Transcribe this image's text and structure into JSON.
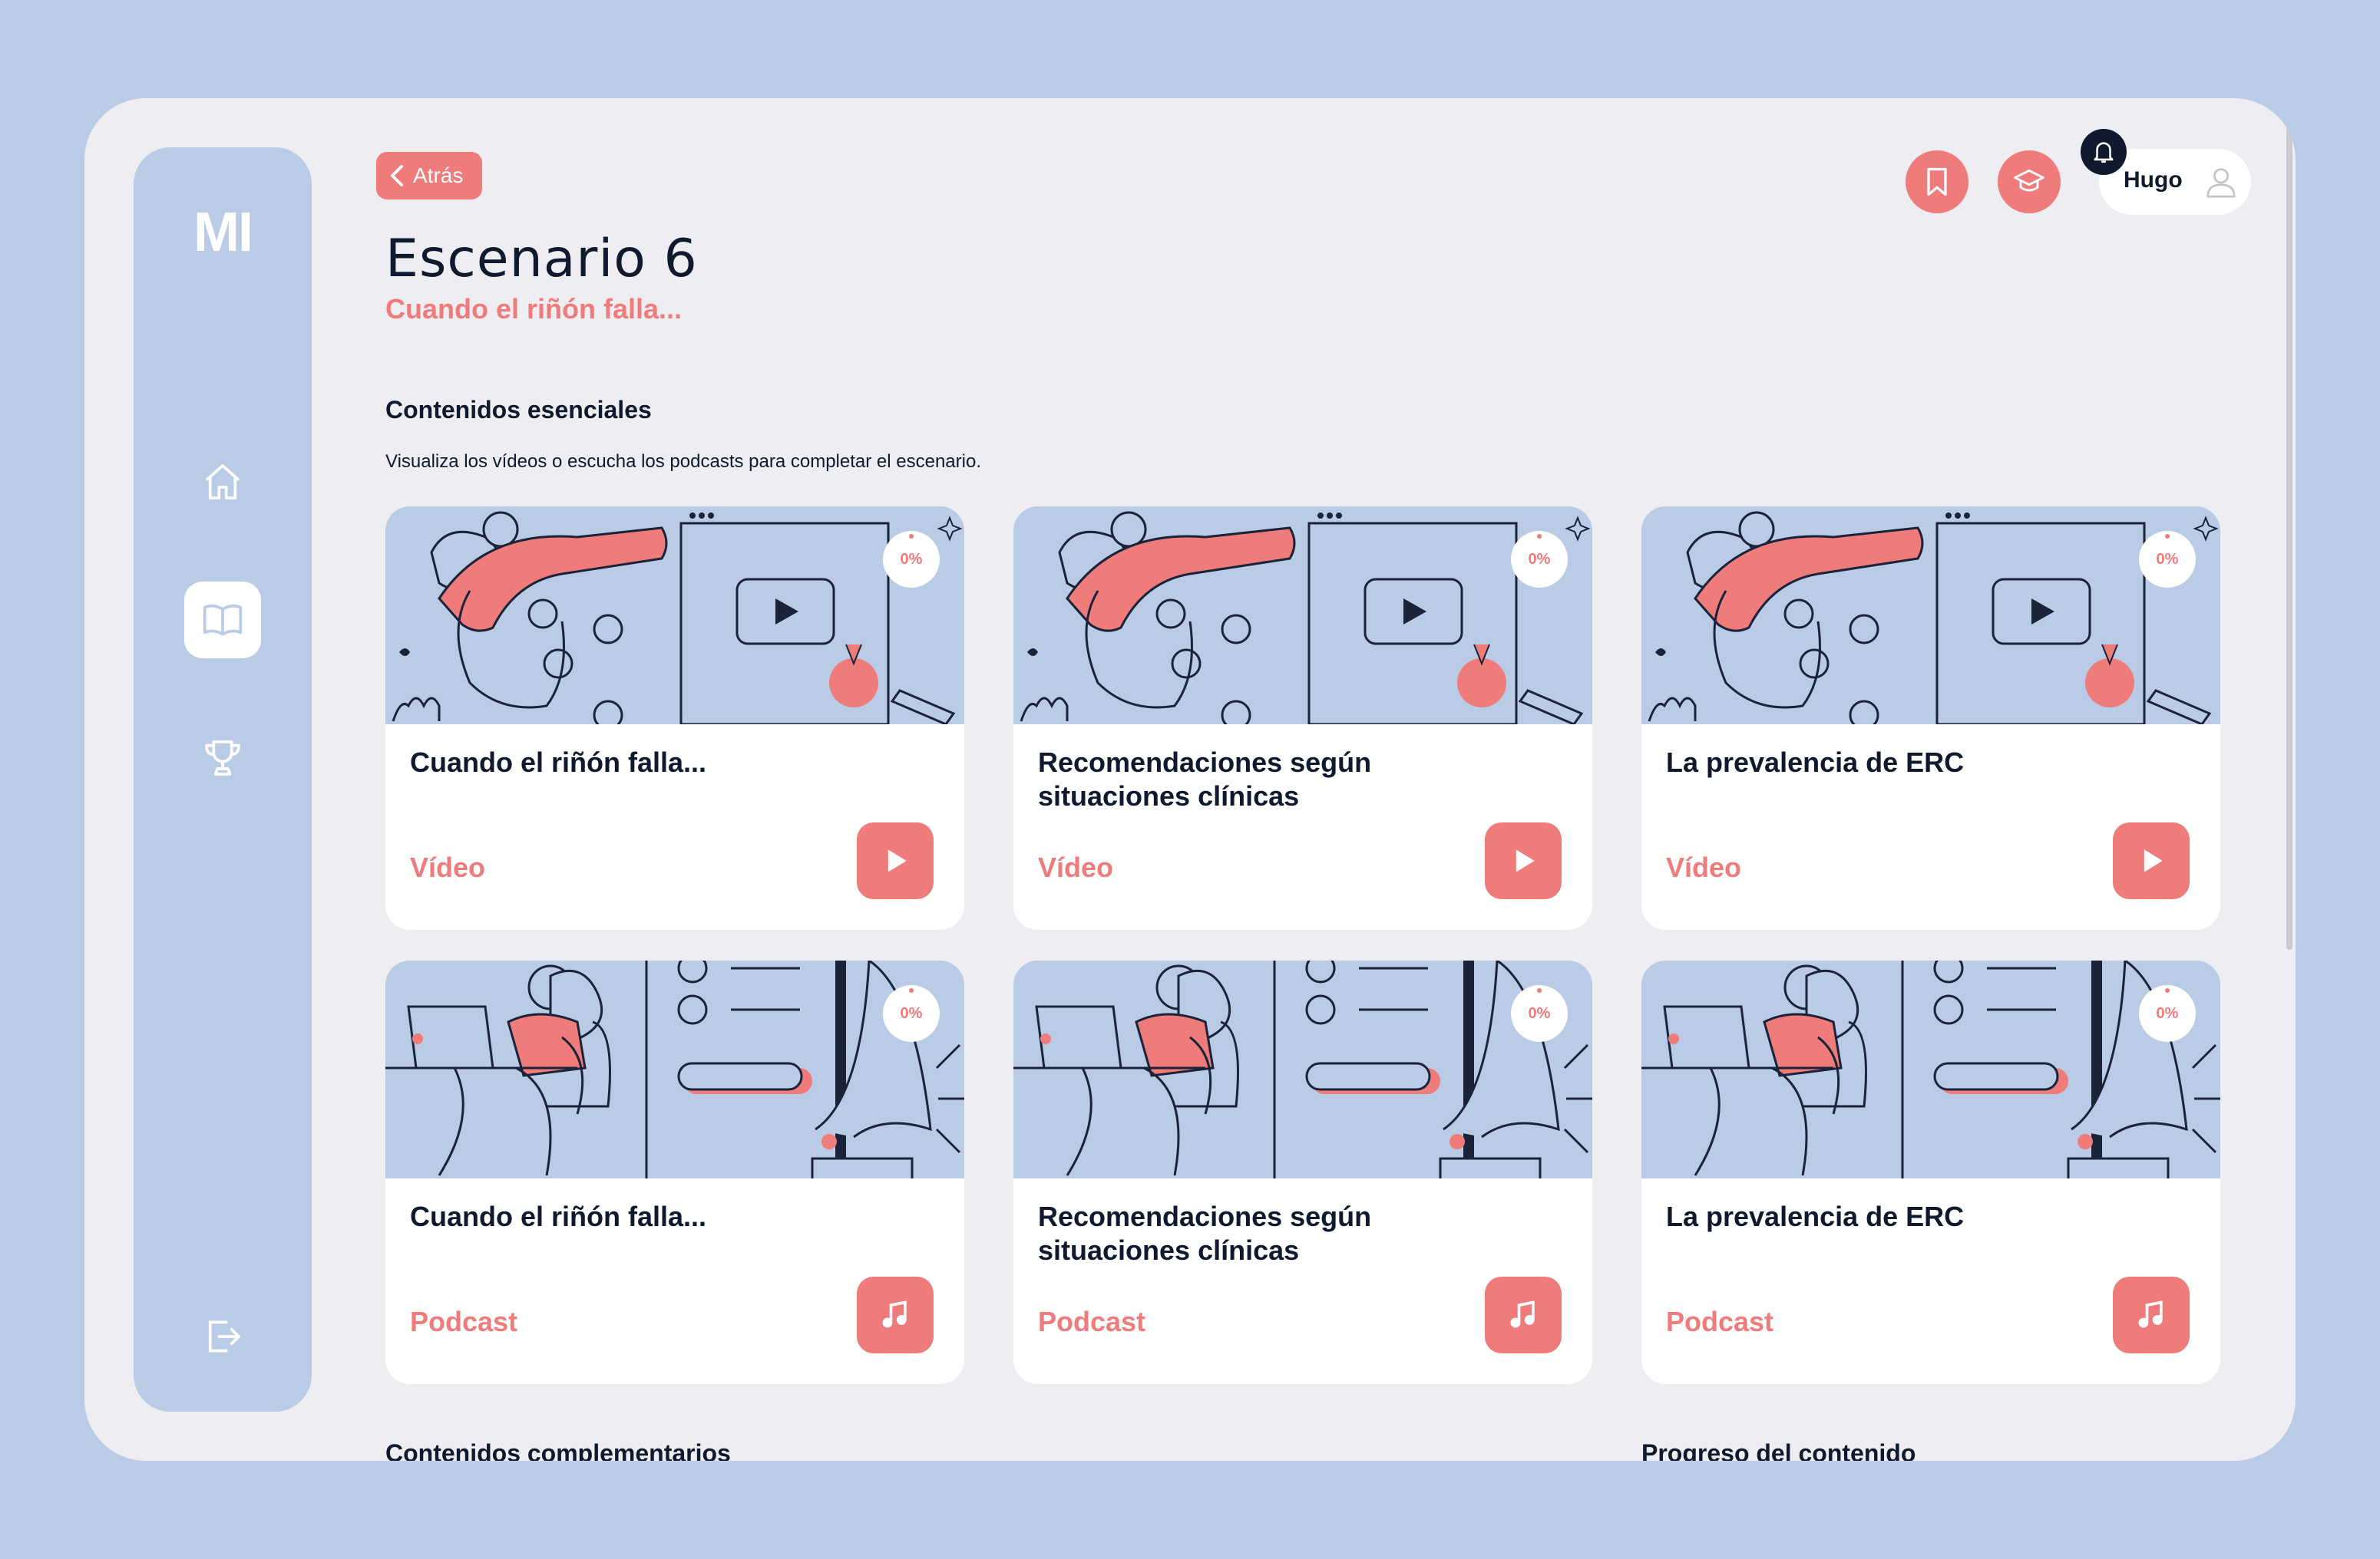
{
  "sidebar": {
    "logo": "MI",
    "items": [
      {
        "icon": "home-icon"
      },
      {
        "icon": "book-icon",
        "active": true
      },
      {
        "icon": "trophy-icon"
      },
      {
        "icon": "logout-icon"
      }
    ]
  },
  "header": {
    "back_label": "Atrás",
    "title": "Escenario 6",
    "subtitle": "Cuando el riñón falla...",
    "user_name": "Hugo",
    "icons": [
      "bookmark-icon",
      "graduation-cap-icon",
      "bell-icon",
      "user-icon"
    ]
  },
  "essentials": {
    "title": "Contenidos esenciales",
    "description": "Visualiza los vídeos o escucha los podcasts para completar el escenario."
  },
  "cards": [
    {
      "title": "Cuando el riñón falla...",
      "type": "Vídeo",
      "progress": "0%"
    },
    {
      "title": "Recomendaciones según situaciones clínicas",
      "type": "Vídeo",
      "progress": "0%"
    },
    {
      "title": "La prevalencia de ERC",
      "type": "Vídeo",
      "progress": "0%"
    },
    {
      "title": "Cuando el riñón falla...",
      "type": "Podcast",
      "progress": "0%"
    },
    {
      "title": "Recomendaciones según situaciones clínicas",
      "type": "Podcast",
      "progress": "0%"
    },
    {
      "title": "La prevalencia de ERC",
      "type": "Podcast",
      "progress": "0%"
    }
  ],
  "bottom": {
    "complementary": "Contenidos complementarios",
    "progress": "Progreso del contenido"
  },
  "colors": {
    "accent": "#ef7b7b",
    "background": "#b9cbe5",
    "panel": "#eeedf2",
    "dark": "#0f1a2e"
  }
}
